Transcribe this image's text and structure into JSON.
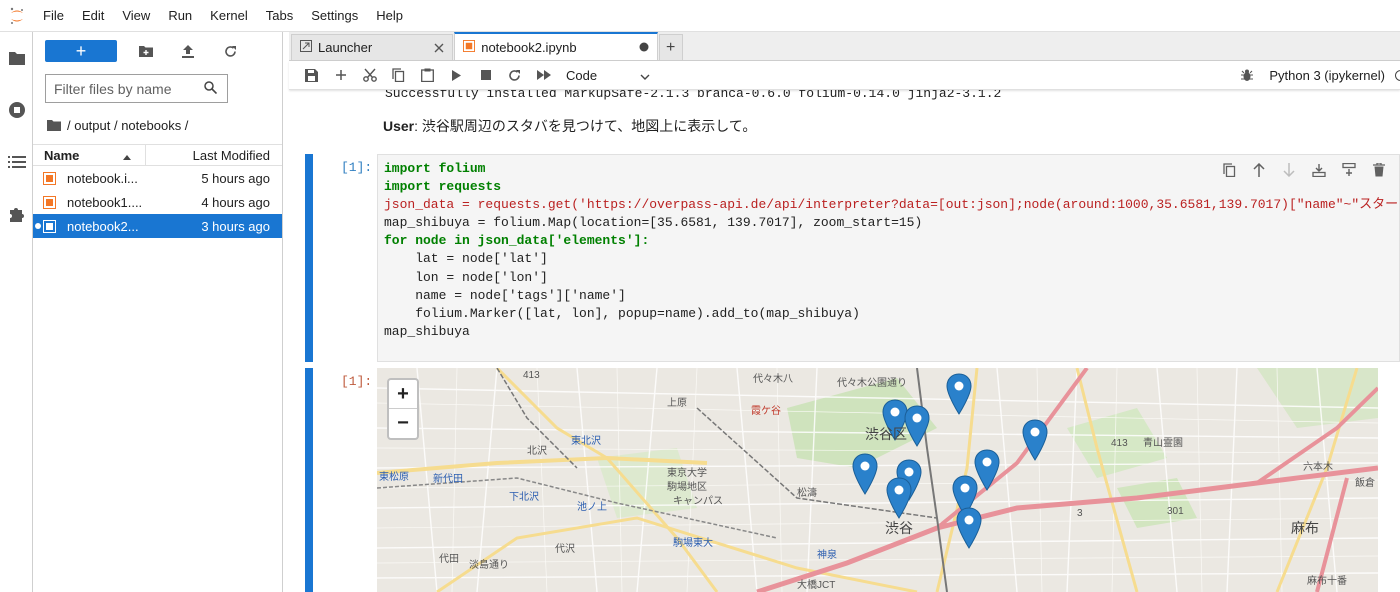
{
  "menu": [
    "File",
    "Edit",
    "View",
    "Run",
    "Kernel",
    "Tabs",
    "Settings",
    "Help"
  ],
  "filebrowser": {
    "filter_placeholder": "Filter files by name",
    "breadcrumb": "/ output / notebooks /",
    "col_name": "Name",
    "col_modified": "Last Modified",
    "files": [
      {
        "name": "notebook.i...",
        "modified": "5 hours ago"
      },
      {
        "name": "notebook1....",
        "modified": "4 hours ago"
      },
      {
        "name": "notebook2...",
        "modified": "3 hours ago"
      }
    ]
  },
  "tabs": [
    {
      "label": "Launcher"
    },
    {
      "label": "notebook2.ipynb"
    }
  ],
  "toolbar": {
    "cell_type": "Code",
    "kernel": "Python 3 (ipykernel)"
  },
  "notebook": {
    "pip_output": "Successfully installed MarkupSafe-2.1.3 branca-0.6.0 folium-0.14.0 jinja2-3.1.2",
    "user_label": "User",
    "user_text": ": 渋谷駅周辺のスタバを見つけて、地図上に表示して。",
    "in_prompt": "[1]:",
    "out_prompt": "[1]:",
    "code_lines": [
      "import folium",
      "import requests",
      "json_data = requests.get('https://overpass-api.de/api/interpreter?data=[out:json];node(around:1000,35.6581,139.7017)[\"name\"~\"スター",
      "map_shibuya = folium.Map(location=[35.6581, 139.7017], zoom_start=15)",
      "for node in json_data['elements']:",
      "    lat = node['lat']",
      "    lon = node['lon']",
      "    name = node['tags']['name']",
      "    folium.Marker([lat, lon], popup=name).add_to(map_shibuya)",
      "map_shibuya"
    ]
  },
  "map": {
    "zoom_in": "+",
    "zoom_out": "−",
    "labels": {
      "shibuya_ku": "渋谷区",
      "shibuya": "渋谷",
      "kitazawa": "北沢",
      "shimokitazawa": "下北沢",
      "higashikitazawa": "東北沢",
      "shinjuku_w": "新代田",
      "higashimatsubara": "東松原",
      "daita": "代田",
      "daizawa": "代沢",
      "ikenoue": "池ノ上",
      "komaba": "駒場東大",
      "matsumi": "松濤",
      "kamiyama": "神泉",
      "uehara": "上原",
      "yoyogi": "代々木八",
      "yoyogi_park": "代々木公園通り",
      "aoyama": "青山霊園",
      "roppongi": "六本木",
      "azabu": "麻布",
      "azabu10": "麻布十番",
      "tokyo_univ": "東京大学",
      "komaba_campus": "駒場地区",
      "campus": "キャンパス",
      "route413": "413",
      "route413b": "413",
      "route3": "3",
      "route301": "301",
      "ohashi": "大橋JCT",
      "iidabashi": "飯倉",
      "kasumicho": "霞ケ谷",
      "awashima": "淡島通り"
    }
  }
}
